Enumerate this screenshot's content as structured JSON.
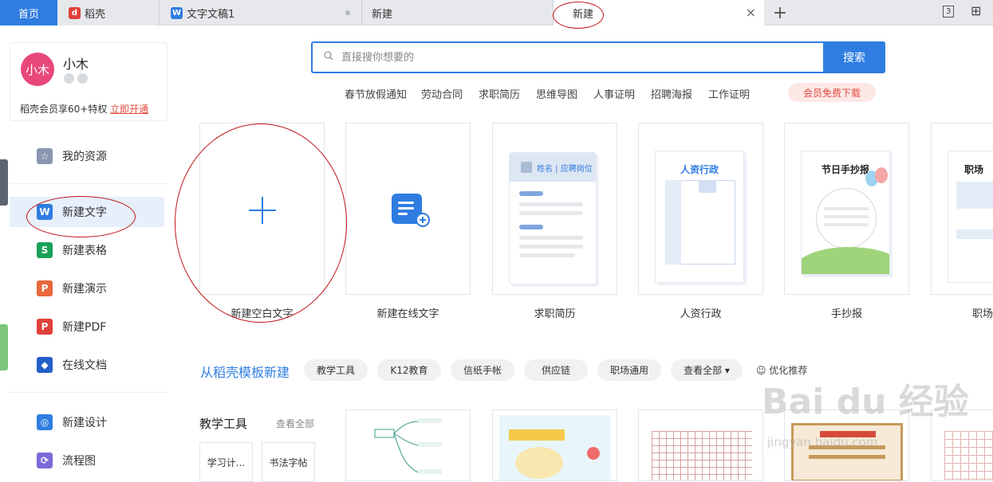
{
  "tabs": {
    "home": "首页",
    "wps": "稻壳",
    "doc": "文字文稿1",
    "new1": "新建",
    "active": "新建",
    "add": "+",
    "close": "×"
  },
  "window_controls": {
    "count": "3",
    "grid": "⊞"
  },
  "profile": {
    "avatar_text": "小木",
    "name": "小木",
    "vip_text": "稻壳会员享60+特权",
    "vip_link": "立即开通"
  },
  "sidebar": {
    "items": [
      {
        "label": "我的资源",
        "icon": "star-icon"
      },
      {
        "label": "新建文字",
        "icon": "writer-icon"
      },
      {
        "label": "新建表格",
        "icon": "spreadsheet-icon"
      },
      {
        "label": "新建演示",
        "icon": "presentation-icon"
      },
      {
        "label": "新建PDF",
        "icon": "pdf-icon"
      },
      {
        "label": "在线文档",
        "icon": "online-doc-icon"
      },
      {
        "label": "新建设计",
        "icon": "design-icon"
      },
      {
        "label": "流程图",
        "icon": "flowchart-icon"
      }
    ]
  },
  "search": {
    "placeholder": "直接搜你想要的",
    "button": "搜索",
    "hot_tags": [
      "春节放假通知",
      "劳动合同",
      "求职简历",
      "思维导图",
      "人事证明",
      "招聘海报",
      "工作证明"
    ],
    "vip_free": "会员免费下载"
  },
  "cards": [
    {
      "label": "新建空白文字"
    },
    {
      "label": "新建在线文字"
    },
    {
      "label": "求职简历",
      "inner": "姓名 | 应聘岗位"
    },
    {
      "label": "人资行政",
      "inner": "人资行政"
    },
    {
      "label": "手抄报",
      "inner": "节日手抄报"
    },
    {
      "label": "职场",
      "inner": "职场"
    }
  ],
  "templates": {
    "title": "从稻壳模板新建",
    "chips": [
      "教学工具",
      "K12教育",
      "信纸手帐",
      "供应链",
      "职场通用",
      "查看全部 ▾"
    ],
    "optimize": "优化推荐",
    "section": "教学工具",
    "view_all": "查看全部",
    "tools": [
      "学习计...",
      "书法字帖"
    ]
  },
  "watermark": {
    "main": "Bai du 经验",
    "sub": "jingyan.baidu.com"
  },
  "colors": {
    "accent": "#2f7de1",
    "annotation": "#c0161a"
  }
}
